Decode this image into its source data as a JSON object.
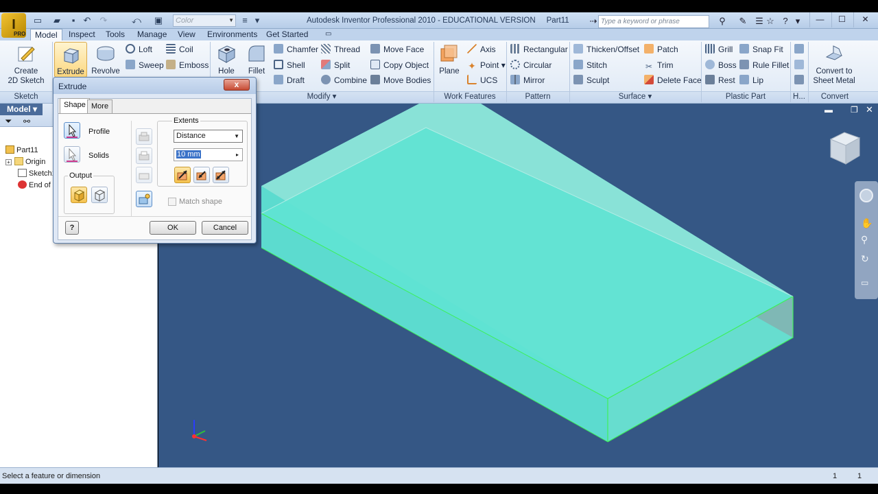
{
  "app": {
    "title": "Autodesk Inventor Professional 2010 - EDUCATIONAL VERSION",
    "document": "Part11",
    "logo_text": "I",
    "logo_sub": "PRO"
  },
  "quick_access": {
    "color_placeholder": "Color",
    "search_placeholder": "Type a keyword or phrase"
  },
  "ribbon_tabs": [
    "Model",
    "Inspect",
    "Tools",
    "Manage",
    "View",
    "Environments",
    "Get Started"
  ],
  "ribbon": {
    "sketch": {
      "create_label_1": "Create",
      "create_label_2": "2D Sketch",
      "panel": "Sketch"
    },
    "create": {
      "extrude": "Extrude",
      "revolve": "Revolve",
      "loft": "Loft",
      "coil": "Coil",
      "sweep": "Sweep",
      "emboss": "Emboss"
    },
    "modify": {
      "hole": "Hole",
      "fillet": "Fillet",
      "chamfer": "Chamfer",
      "thread": "Thread",
      "move_face": "Move Face",
      "shell": "Shell",
      "split": "Split",
      "copy_object": "Copy Object",
      "draft": "Draft",
      "combine": "Combine",
      "move_bodies": "Move Bodies",
      "panel": "Modify"
    },
    "work_features": {
      "plane": "Plane",
      "axis": "Axis",
      "point": "Point",
      "ucs": "UCS",
      "panel": "Work Features"
    },
    "pattern": {
      "rectangular": "Rectangular",
      "circular": "Circular",
      "mirror": "Mirror",
      "panel": "Pattern"
    },
    "surface": {
      "thicken": "Thicken/Offset",
      "patch": "Patch",
      "stitch": "Stitch",
      "trim": "Trim",
      "sculpt": "Sculpt",
      "delete_face": "Delete Face",
      "panel": "Surface"
    },
    "plastic": {
      "grill": "Grill",
      "snap_fit": "Snap Fit",
      "boss": "Boss",
      "rule_fillet": "Rule Fillet",
      "rest": "Rest",
      "lip": "Lip",
      "panel": "Plastic Part"
    },
    "harness": {
      "panel": "H..."
    },
    "convert": {
      "label_1": "Convert to",
      "label_2": "Sheet Metal",
      "panel": "Convert"
    }
  },
  "browser": {
    "header": "Model",
    "items": [
      "Part11",
      "Origin",
      "Sketch1",
      "End of Part"
    ]
  },
  "dialog": {
    "title": "Extrude",
    "close": "x",
    "tabs": [
      "Shape",
      "More"
    ],
    "profile": "Profile",
    "solids": "Solids",
    "output": "Output",
    "extents": "Extents",
    "extents_type": "Distance",
    "distance": "10 mm",
    "match_shape": "Match shape",
    "help": "?",
    "ok": "OK",
    "cancel": "Cancel"
  },
  "status": {
    "text": "Select a feature or dimension",
    "n1": "1",
    "n2": "1"
  },
  "colors": {
    "viewport_bg": "#355785",
    "part_face": "#5fe3d3",
    "part_edge": "#3df05a"
  }
}
